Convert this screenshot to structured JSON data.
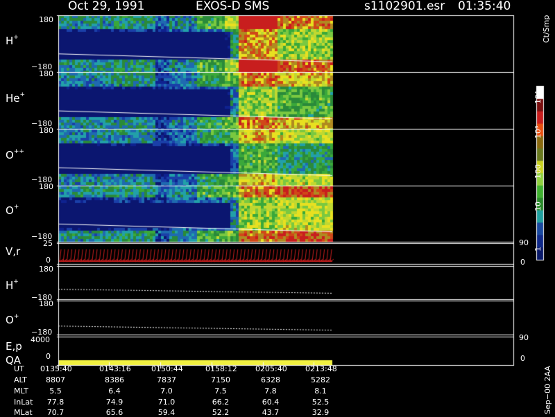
{
  "header": {
    "date": "Oct 29, 1991",
    "instrument": "EXOS-D SMS",
    "file": "s1102901.esr",
    "time": "01:35:40"
  },
  "colors": {
    "background": "#000000",
    "low": "#0a1a8c",
    "mid": "#3aa83a",
    "high": "#e8e020",
    "extreme": "#c81e1e",
    "trace": "#ffffff",
    "qa": "#f0f040",
    "vr": "#c81e1e"
  },
  "panels": [
    {
      "id": "h-plus",
      "label": "H",
      "sup": "+",
      "ytop": "180",
      "ybot": "−180",
      "type": "spectrogram",
      "intensity": [
        0.2,
        0.3,
        0.5,
        0.8,
        0.6
      ]
    },
    {
      "id": "he-plus",
      "label": "He",
      "sup": "+",
      "ytop": "180",
      "ybot": "−180",
      "type": "spectrogram",
      "intensity": [
        0.15,
        0.2,
        0.4,
        0.6,
        0.5
      ]
    },
    {
      "id": "o-plus-plus",
      "label": "O",
      "sup": "++",
      "ytop": "180",
      "ybot": "−180",
      "type": "spectrogram",
      "intensity": [
        0.12,
        0.18,
        0.35,
        0.5,
        0.4
      ]
    },
    {
      "id": "o-plus",
      "label": "O",
      "sup": "+",
      "ytop": "180",
      "ybot": "−180",
      "type": "spectrogram",
      "intensity": [
        0.2,
        0.3,
        0.5,
        0.6,
        0.65
      ]
    },
    {
      "id": "vr",
      "label": "V,r",
      "sup": "",
      "ytop": "25",
      "ybot": "0",
      "rtop": "90",
      "rbot": "0",
      "type": "vectors"
    },
    {
      "id": "h-plus-2",
      "label": "H",
      "sup": "+",
      "ytop": "180",
      "ybot": "−180",
      "type": "trace"
    },
    {
      "id": "o-plus-2",
      "label": "O",
      "sup": "+",
      "ytop": "180",
      "ybot": "−180",
      "type": "trace"
    },
    {
      "id": "ep-qa",
      "label": "E,p",
      "label2": "QA",
      "sup": "",
      "ytop": "4000",
      "ybot": "0",
      "rtop": "90",
      "rbot": "0",
      "type": "qa"
    }
  ],
  "colorbar": {
    "unit": "Ct/Smp",
    "labels": [
      "10⁴",
      "10³",
      "100",
      "10",
      "1"
    ],
    "stops": [
      "#ffffff",
      "#7a1010",
      "#c81e1e",
      "#e85010",
      "#8a6a10",
      "#6a7a20",
      "#c8d020",
      "#90d040",
      "#40b030",
      "#2a8a2a",
      "#20a0a0",
      "#1a4aa0",
      "#102a8a",
      "#0a1a6a"
    ]
  },
  "chart_data": {
    "type": "heatmap",
    "title": "Oct 29, 1991   EXOS-D SMS",
    "x_ticks": [
      "0135:40",
      "0143:16",
      "0150:44",
      "0158:12",
      "0205:40",
      "0213:48"
    ],
    "ephemeris": [
      {
        "name": "UT",
        "values": [
          "0135:40",
          "0143:16",
          "0150:44",
          "0158:12",
          "0205:40",
          "0213:48"
        ]
      },
      {
        "name": "ALT",
        "values": [
          "8807",
          "8386",
          "7837",
          "7150",
          "6328",
          "5282"
        ]
      },
      {
        "name": "MLT",
        "values": [
          "5.5",
          "6.4",
          "7.0",
          "7.5",
          "7.8",
          "8.1"
        ]
      },
      {
        "name": "InLat",
        "values": [
          "77.8",
          "74.9",
          "71.0",
          "66.2",
          "60.4",
          "52.5"
        ]
      },
      {
        "name": "MLat",
        "values": [
          "70.7",
          "65.6",
          "59.4",
          "52.2",
          "43.7",
          "32.9"
        ]
      }
    ],
    "ylim": [
      -180,
      180
    ],
    "footer": "Sep−00  2AA"
  }
}
